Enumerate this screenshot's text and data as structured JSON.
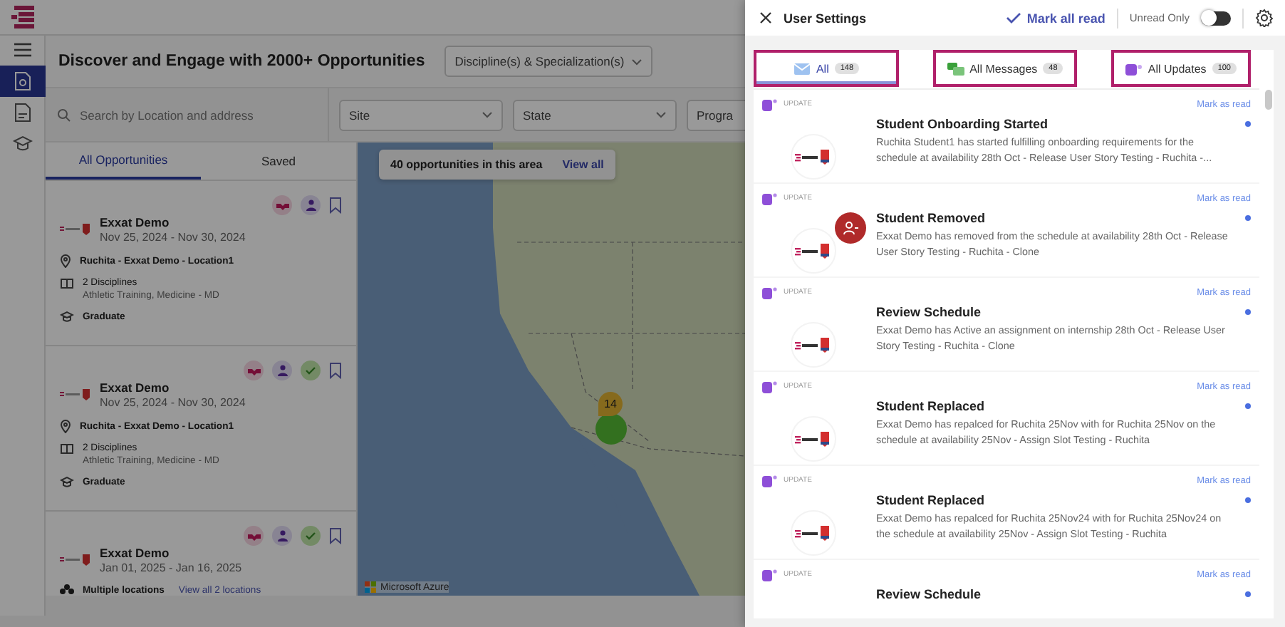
{
  "nav": [
    {
      "kind": "opportunities",
      "selected": true
    },
    {
      "kind": "document",
      "selected": false
    },
    {
      "kind": "graduation",
      "selected": false
    }
  ],
  "page": {
    "title": "Discover and Engage with 2000+ Opportunities",
    "discipline_filter": {
      "placeholder": "Discipline(s) & Specialization(s)"
    }
  },
  "search": {
    "placeholder": "Search by Location and address"
  },
  "filters": [
    {
      "placeholder": "Site"
    },
    {
      "placeholder": "State"
    },
    {
      "placeholder": "Progra"
    }
  ],
  "list_tabs": [
    {
      "label": "All Opportunities",
      "selected": true
    },
    {
      "label": "Saved",
      "selected": false
    }
  ],
  "cards": [
    {
      "name": "Exxat Demo",
      "dates": "Nov 25, 2024 - Nov 30, 2024",
      "approved": false,
      "location": {
        "kind": "single",
        "text": "Ruchita - Exxat Demo - Location1"
      },
      "disciplines_count": "2 Disciplines",
      "disciplines": "Athletic Training, Medicine - MD",
      "program_level": "Graduate"
    },
    {
      "name": "Exxat Demo",
      "dates": "Nov 25, 2024 - Nov 30, 2024",
      "approved": true,
      "location": {
        "kind": "single",
        "text": "Ruchita - Exxat Demo - Location1"
      },
      "disciplines_count": "2 Disciplines",
      "disciplines": "Athletic Training, Medicine - MD",
      "program_level": "Graduate"
    },
    {
      "name": "Exxat Demo",
      "dates": "Jan 01, 2025 - Jan 16, 2025",
      "approved": true,
      "location": {
        "kind": "multiple",
        "text": "Multiple locations",
        "link": "View all 2 locations"
      }
    }
  ],
  "map": {
    "banner": "40 opportunities in this area",
    "banner_link": "View all",
    "cluster": "14",
    "attribution": "Microsoft Azure"
  },
  "panel": {
    "title": "User Settings",
    "mark_all": "Mark all read",
    "unread_only": {
      "label": "Unread Only",
      "on": false
    },
    "tabs": [
      {
        "kind": "all",
        "label": "All",
        "count": "148",
        "selected": true,
        "highlighted": true
      },
      {
        "kind": "messages",
        "label": "All Messages",
        "count": "48",
        "selected": false,
        "highlighted": true
      },
      {
        "kind": "updates",
        "label": "All Updates",
        "count": "100",
        "selected": false,
        "highlighted": true
      }
    ],
    "notifications": [
      {
        "tag": "UPDATE",
        "action": "Mark as read",
        "kind": "logo",
        "title": "Student Onboarding Started",
        "text": "Ruchita Student1 has started fulfilling onboarding requirements for the schedule at availability 28th Oct - Release User Story Testing - Ruchita -...",
        "unread": true
      },
      {
        "tag": "UPDATE",
        "action": "Mark as read",
        "kind": "removed",
        "title": "Student Removed",
        "text": "Exxat Demo has removed from the schedule at availability 28th Oct - Release User Story Testing - Ruchita - Clone",
        "unread": true
      },
      {
        "tag": "UPDATE",
        "action": "Mark as read",
        "kind": "logo",
        "title": "Review Schedule",
        "text": "Exxat Demo has Active an assignment on internship 28th Oct - Release User Story Testing - Ruchita - Clone",
        "unread": true
      },
      {
        "tag": "UPDATE",
        "action": "Mark as read",
        "kind": "logo",
        "title": "Student Replaced",
        "text": "Exxat Demo has repalced for Ruchita 25Nov with for Ruchita 25Nov on the schedule at availability 25Nov - Assign Slot Testing - Ruchita",
        "unread": true
      },
      {
        "tag": "UPDATE",
        "action": "Mark as read",
        "kind": "logo",
        "title": "Student Replaced",
        "text": "Exxat Demo has repalced for Ruchita 25Nov24 with for Ruchita 25Nov24 on the schedule at availability 25Nov - Assign Slot Testing - Ruchita",
        "unread": true
      },
      {
        "tag": "UPDATE",
        "action": "Mark as read",
        "kind": "none",
        "title": "Review Schedule",
        "unread": true
      }
    ]
  }
}
